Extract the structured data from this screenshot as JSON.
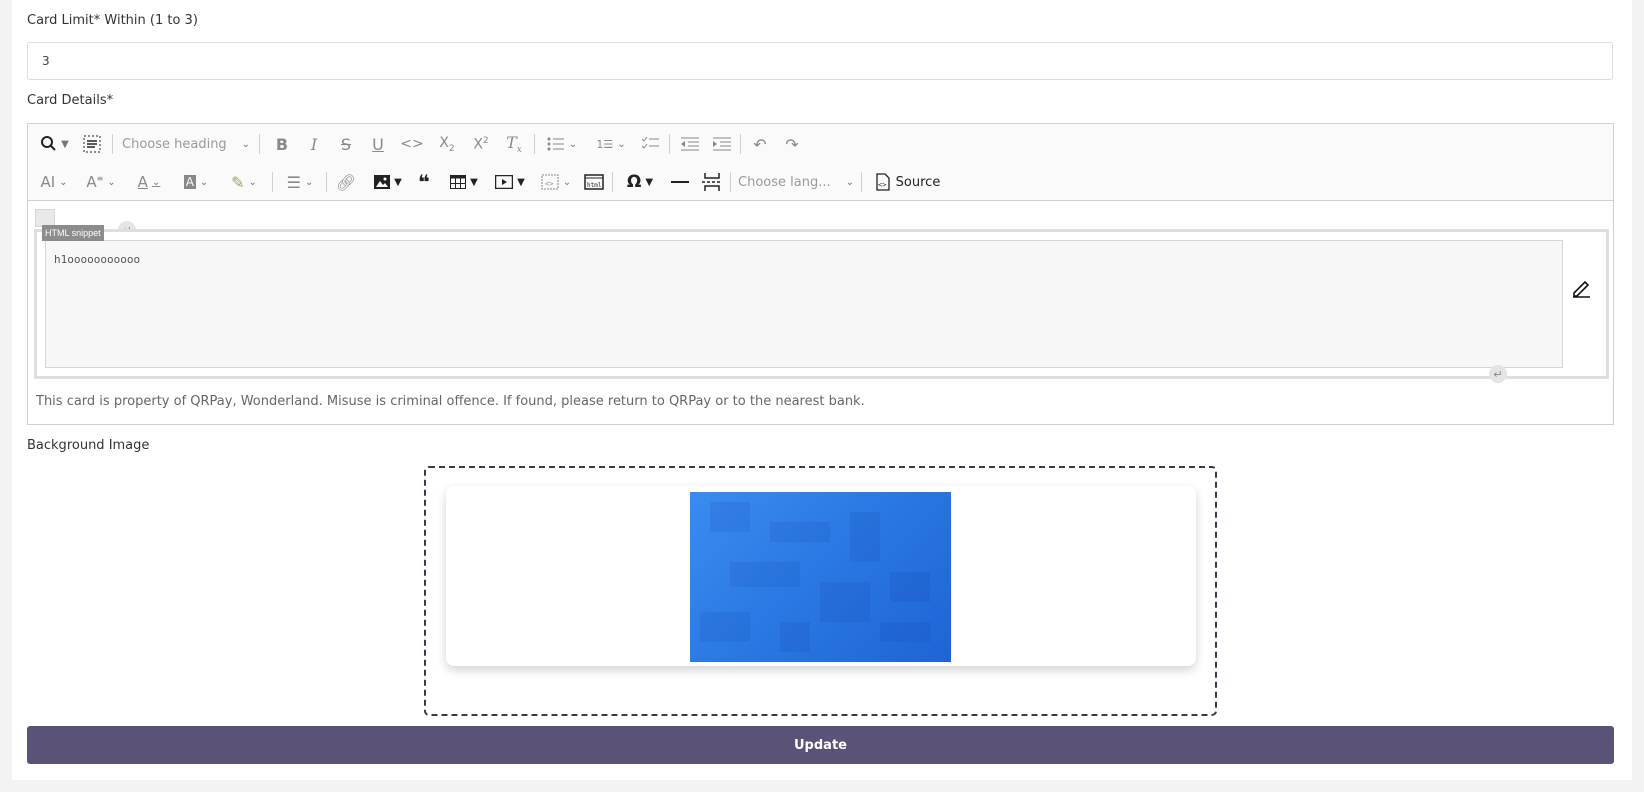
{
  "card_limit": {
    "label": "Card Limit* Within (1 to 3)",
    "value": "3"
  },
  "card_details": {
    "label": "Card Details*",
    "toolbar": {
      "heading_placeholder": "Choose heading",
      "language_placeholder": "Choose lang...",
      "source_label": "Source",
      "icons_row1": [
        "find-replace-icon",
        "select-all-icon",
        "bold-icon",
        "italic-icon",
        "strikethrough-icon",
        "underline-icon",
        "code-icon",
        "subscript-icon",
        "superscript-icon",
        "remove-format-icon",
        "bulleted-list-icon",
        "numbered-list-icon",
        "todo-list-icon",
        "outdent-icon",
        "indent-icon",
        "undo-icon",
        "redo-icon"
      ],
      "icons_row2": [
        "font-size-icon",
        "font-family-icon",
        "font-color-icon",
        "font-background-icon",
        "highlight-icon",
        "align-icon",
        "link-icon",
        "image-icon",
        "blockquote-icon",
        "table-icon",
        "media-icon",
        "html-embed-icon",
        "code-block-icon",
        "special-chars-icon",
        "horizontal-line-icon",
        "page-break-icon",
        "source-icon"
      ]
    },
    "snippet_tag": "HTML snippet",
    "snippet_content": "h1ooooooooooo",
    "footnote": "This card is property of QRPay, Wonderland. Misuse is criminal offence. If found, please return to QRPay or to the nearest bank."
  },
  "background_image": {
    "label": "Background Image"
  },
  "submit_label": "Update"
}
